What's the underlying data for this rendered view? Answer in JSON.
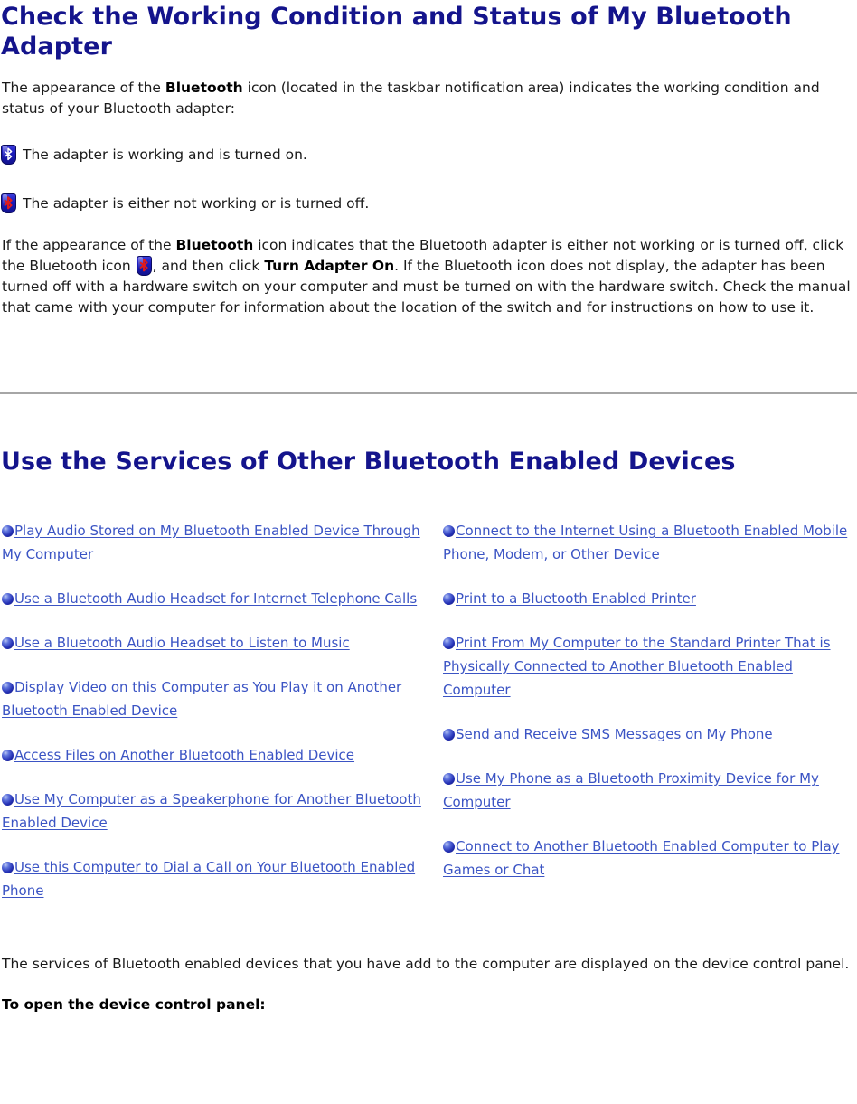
{
  "section_one": {
    "heading": "Check the Working Condition and Status of My Bluetooth Adapter",
    "intro_part1": "The appearance of the ",
    "intro_bold": "Bluetooth",
    "intro_part2": " icon (located in the taskbar notification area) indicates the working condition and status of your Bluetooth adapter:",
    "status_items": [
      {
        "icon": "bluetooth-adapter-on-icon",
        "icon_state": "on",
        "text": "The adapter is working and is turned on."
      },
      {
        "icon": "bluetooth-adapter-off-icon",
        "icon_state": "off",
        "text": "The adapter is either not working or is turned off."
      }
    ],
    "detail_part1": "If the appearance of the ",
    "detail_bold1": "Bluetooth",
    "detail_part2": " icon indicates that the Bluetooth adapter is either not working or is turned off, click the Bluetooth icon ",
    "detail_part3": ", and then click ",
    "detail_bold2": "Turn Adapter On",
    "detail_part4": ". If the Bluetooth icon does not display, the adapter has been turned off with a hardware switch on your computer and must be turned on with the hardware switch. Check the manual that came with your computer for information about the location of the switch and for instructions on how to use it."
  },
  "section_two": {
    "heading": "Use the Services of Other Bluetooth Enabled Devices",
    "links_left": [
      "Play Audio Stored on My Bluetooth Enabled Device Through My Computer",
      "Use a Bluetooth Audio Headset for Internet Telephone Calls",
      "Use a Bluetooth Audio Headset to Listen to Music",
      "Display Video on this Computer as You Play it on Another Bluetooth Enabled Device",
      "Access Files on Another Bluetooth Enabled Device",
      "Use My Computer as a Speakerphone for Another Bluetooth Enabled Device",
      "Use this Computer to Dial a Call on Your Bluetooth Enabled Phone"
    ],
    "links_right": [
      "Connect to the Internet Using a Bluetooth Enabled Mobile Phone, Modem, or Other Device",
      "Print to a Bluetooth Enabled Printer",
      "Print From My Computer to the Standard Printer That is Physically Connected to Another Bluetooth Enabled Computer",
      "Send and Receive SMS Messages on My Phone",
      "Use My Phone as a Bluetooth Proximity Device for My Computer",
      "Connect to Another Bluetooth Enabled Computer to Play Games or Chat"
    ],
    "bullet_icon": "blue-sphere-bullet-icon",
    "closing_text": "The services of Bluetooth enabled devices that you have add to the computer are displayed on the device control panel.",
    "closing_bold": "To open the device control panel:"
  },
  "colors": {
    "heading": "#14148C",
    "link": "#3B54C4",
    "divider": "#A6A6A6",
    "body_text": "#1A1A1A",
    "shield_blue": "#1B1BBE",
    "rune_off_red": "#D81F1F"
  }
}
